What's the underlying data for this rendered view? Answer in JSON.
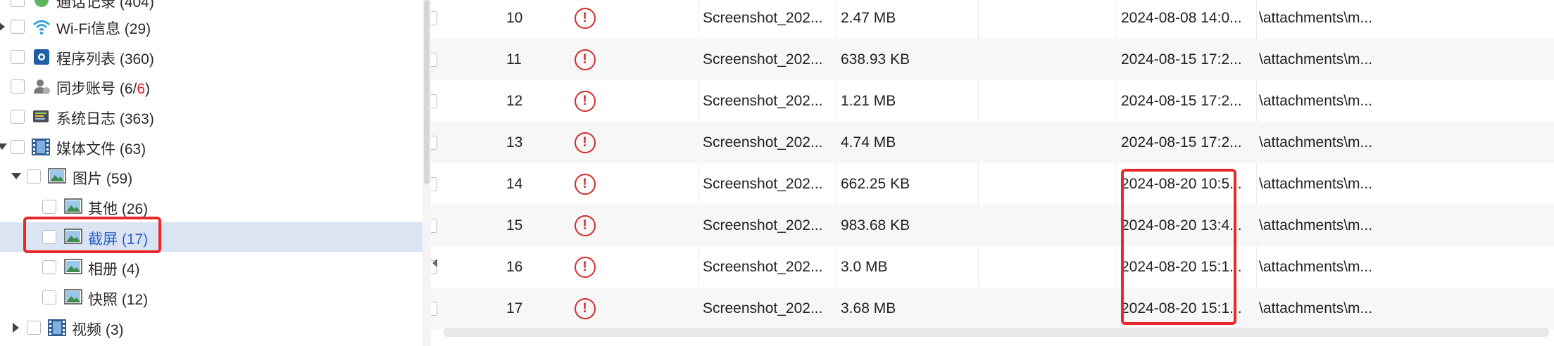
{
  "tree": {
    "items": [
      {
        "label": "通话记录 (404)"
      },
      {
        "label": "Wi-Fi信息 (29)"
      },
      {
        "label": "程序列表 (360)"
      },
      {
        "label_prefix": "同步账号 (6/",
        "label_red": "6",
        "label_suffix": ")"
      },
      {
        "label": "系统日志 (363)"
      },
      {
        "label": "媒体文件 (63)"
      },
      {
        "label": "图片 (59)"
      },
      {
        "label": "其他 (26)"
      },
      {
        "label": "截屏 (17)"
      },
      {
        "label": "相册 (4)"
      },
      {
        "label": "快照 (12)"
      },
      {
        "label": "视频 (3)"
      }
    ]
  },
  "table": {
    "rows": [
      {
        "index": "10",
        "name": "Screenshot_202...",
        "size": "2.47 MB",
        "time": "2024-08-08 14:0...",
        "path": "\\attachments\\m..."
      },
      {
        "index": "11",
        "name": "Screenshot_202...",
        "size": "638.93 KB",
        "time": "2024-08-15 17:2...",
        "path": "\\attachments\\m..."
      },
      {
        "index": "12",
        "name": "Screenshot_202...",
        "size": "1.21 MB",
        "time": "2024-08-15 17:2...",
        "path": "\\attachments\\m..."
      },
      {
        "index": "13",
        "name": "Screenshot_202...",
        "size": "4.74 MB",
        "time": "2024-08-15 17:2...",
        "path": "\\attachments\\m..."
      },
      {
        "index": "14",
        "name": "Screenshot_202...",
        "size": "662.25 KB",
        "time": "2024-08-20 10:5...",
        "path": "\\attachments\\m..."
      },
      {
        "index": "15",
        "name": "Screenshot_202...",
        "size": "983.68 KB",
        "time": "2024-08-20 13:4...",
        "path": "\\attachments\\m..."
      },
      {
        "index": "16",
        "name": "Screenshot_202...",
        "size": "3.0 MB",
        "time": "2024-08-20 15:1...",
        "path": "\\attachments\\m..."
      },
      {
        "index": "17",
        "name": "Screenshot_202...",
        "size": "3.68 MB",
        "time": "2024-08-20 15:1...",
        "path": "\\attachments\\m..."
      }
    ],
    "warning_symbol": "!"
  },
  "colors": {
    "highlight": "#e8282b",
    "selected_row": "#dbe4f3",
    "selected_text": "#2d62c8",
    "warning": "#d62b2b"
  },
  "icons": [
    "wifi-icon",
    "program-list-icon",
    "sync-account-icon",
    "system-log-icon",
    "media-file-icon",
    "image-icon",
    "video-icon",
    "warning-icon"
  ]
}
